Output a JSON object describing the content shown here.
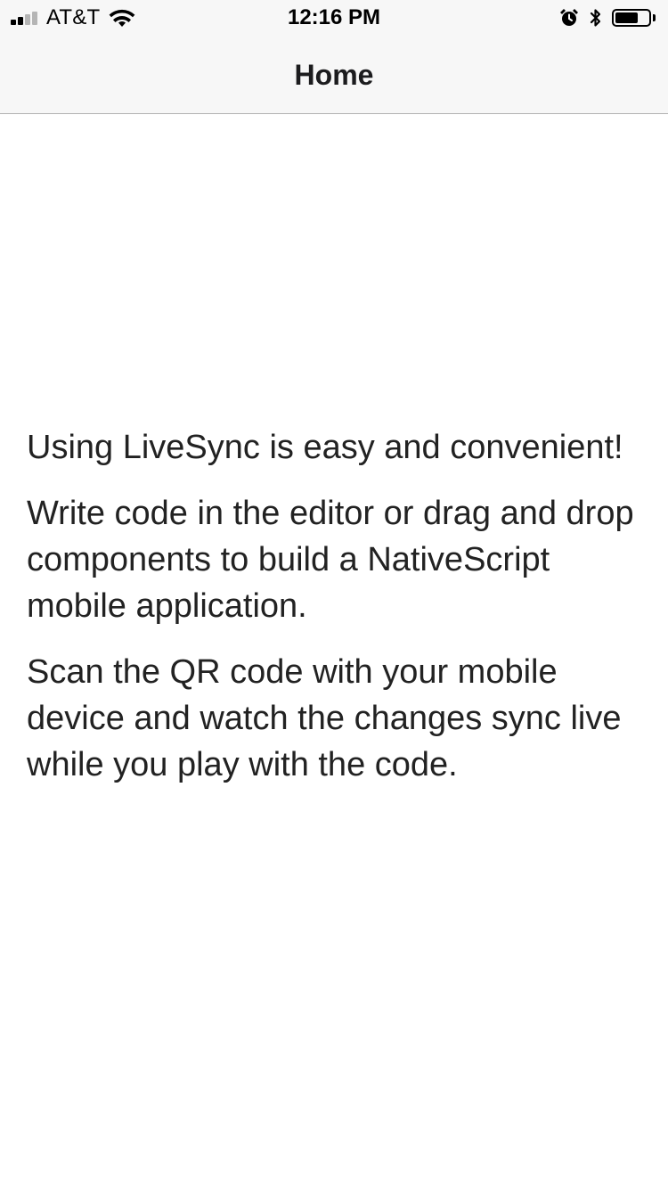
{
  "status_bar": {
    "carrier": "AT&T",
    "time": "12:16 PM",
    "signal_bars_filled": 2,
    "signal_bars_total": 4,
    "battery_level": 0.7,
    "icons": [
      "signal-icon",
      "wifi-icon",
      "alarm-icon",
      "bluetooth-icon",
      "battery-icon"
    ]
  },
  "nav": {
    "title": "Home"
  },
  "content": {
    "paragraphs": [
      "Using LiveSync is easy and convenient!",
      "Write code in the editor or drag and drop components to build a NativeScript mobile application.",
      "Scan the QR code with your mobile device and watch the changes sync live while you play with the code."
    ]
  },
  "colors": {
    "bar_background": "#f7f7f7",
    "separator": "#b2b2b2",
    "text": "#222222"
  }
}
